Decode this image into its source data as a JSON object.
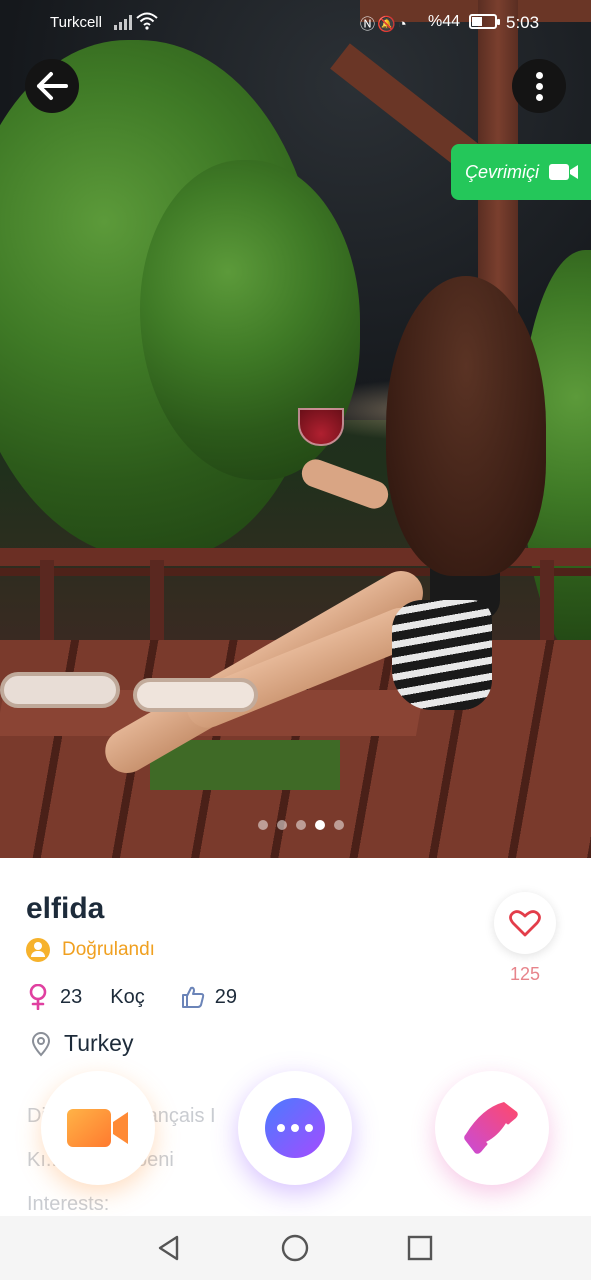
{
  "status_bar": {
    "carrier": "Turkcell",
    "battery": "%44",
    "battery_level": 0.44,
    "time": "5:03"
  },
  "photo": {
    "online_label": "Çevrimiçi",
    "page_count": 5,
    "active_page": 4
  },
  "profile": {
    "name": "elfida",
    "verified_label": "Doğrulandı",
    "age": "23",
    "zodiac": "Koç",
    "likes": "29",
    "location": "Turkey",
    "heart_count": "125",
    "bio_lines": [
      "Dil: Türkçe Français I",
      "Kı... Ankara beni",
      "Interests:"
    ]
  },
  "colors": {
    "online_green": "#24c75a",
    "verified_orange": "#f0a020",
    "female_pink": "#e040a0",
    "heart_red": "#e33d4a",
    "name_dark": "#1d2b3a"
  },
  "icons": {
    "back": "arrow-left-icon",
    "more": "more-vertical-icon",
    "online_camera": "video-camera-icon",
    "verified": "user-check-icon",
    "gender": "female-icon",
    "like": "thumbs-up-icon",
    "location": "location-pin-icon",
    "heart": "heart-icon",
    "video_call": "video-call-icon",
    "message": "chat-bubble-icon",
    "voice_call": "phone-icon"
  }
}
